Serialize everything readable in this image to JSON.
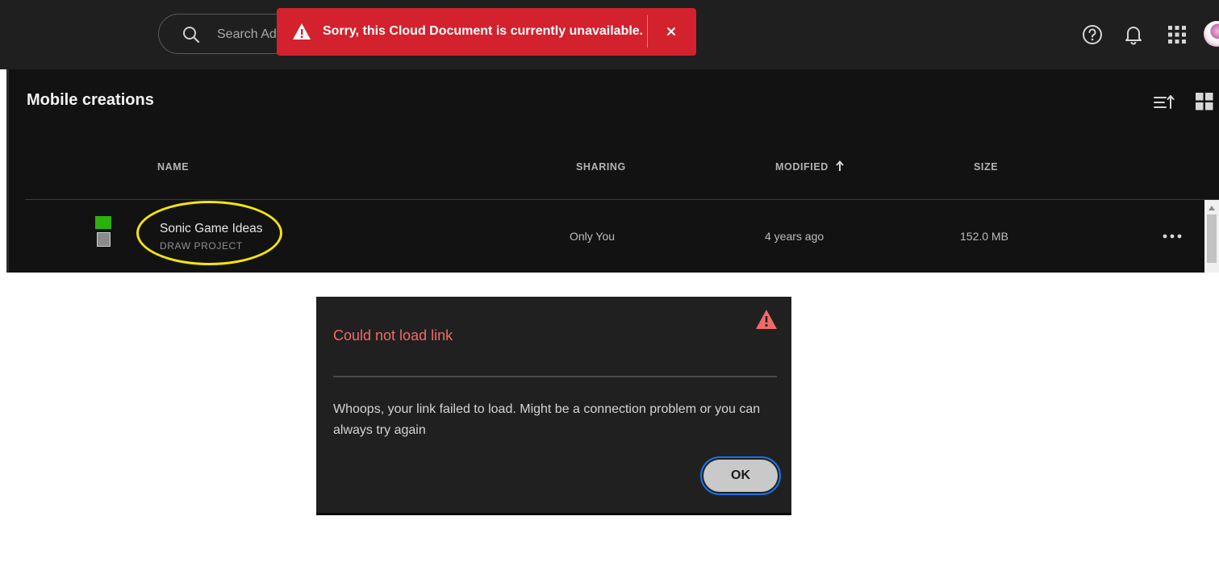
{
  "header": {
    "search": {
      "placeholder": "Search Ad",
      "icon": "search-icon"
    },
    "icons": [
      "help-icon",
      "bell-icon",
      "apps-grid-icon"
    ]
  },
  "toast": {
    "message": "Sorry, this Cloud Document is currently unavailable.",
    "icon": "warning-icon",
    "color": "#d3212d"
  },
  "main": {
    "title": "Mobile creations",
    "columns": {
      "name": "NAME",
      "sharing": "SHARING",
      "modified": "MODIFIED",
      "size": "SIZE"
    },
    "rows": [
      {
        "name": "Sonic Game Ideas",
        "type": "DRAW PROJECT",
        "sharing": "Only You",
        "modified": "4 years ago",
        "size": "152.0 MB"
      }
    ]
  },
  "dialog": {
    "title": "Could not load link",
    "message": "Whoops, your link failed to load. Might be a connection problem or you can always try again",
    "ok_label": "OK",
    "title_color": "#f26a66"
  },
  "colors": {
    "topbar": "#1f1f1f",
    "content": "#121212",
    "highlight": "#f5e50a",
    "focus_ring": "#1a73e8"
  }
}
